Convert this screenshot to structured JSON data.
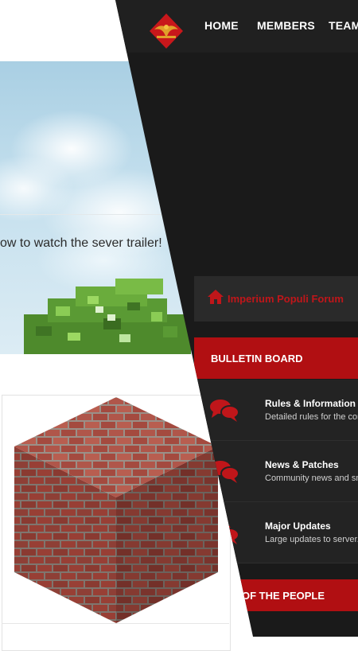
{
  "left_page": {
    "trailer_text": "ow to watch the sever trailer!"
  },
  "navbar": {
    "logo_icon": "imperium-eagle-logo",
    "items": [
      {
        "label": "HOME"
      },
      {
        "label": "MEMBERS"
      },
      {
        "label": "TEAM"
      }
    ]
  },
  "forum": {
    "home_icon": "home-icon",
    "title": "Imperium Populi Forum"
  },
  "bulletin_board": {
    "title": "BULLETIN BOARD",
    "rows": [
      {
        "icon": "chat-bubbles-icon",
        "title": "Rules & Information",
        "description": "Detailed rules for the com"
      },
      {
        "icon": "chat-bubbles-icon",
        "title": "News & Patches",
        "description": "Community news and sm"
      },
      {
        "icon": "chat-bubbles-icon",
        "title": "Major Updates",
        "description": "Large updates to server."
      }
    ]
  },
  "people_section": {
    "title": "OF THE PEOPLE"
  },
  "colors": {
    "accent_red": "#b10f12",
    "forum_title_red": "#c0161a",
    "dark_bg": "#1a1a1a"
  }
}
